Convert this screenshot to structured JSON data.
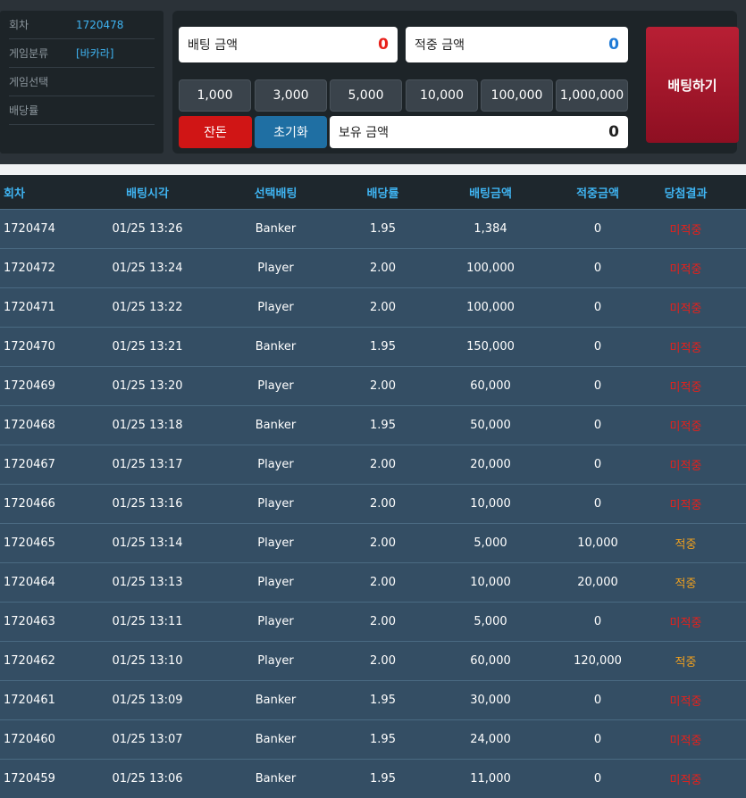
{
  "info": {
    "round_label": "회차",
    "round_value": "1720478",
    "category_label": "게임분류",
    "category_value": "[바카라]",
    "select_label": "게임선택",
    "select_value": "",
    "odds_label": "배당률",
    "odds_value": ""
  },
  "bet": {
    "amount_label": "배팅 금액",
    "amount_value": "0",
    "win_label": "적중 금액",
    "win_value": "0",
    "chips": [
      "1,000",
      "3,000",
      "5,000",
      "10,000",
      "100,000",
      "1,000,000"
    ],
    "change_label": "잔돈",
    "reset_label": "초기화",
    "balance_label": "보유 금액",
    "balance_value": "0",
    "submit_label": "배팅하기"
  },
  "colors": {
    "lose": "#e8201a",
    "win": "#f0a01e",
    "header_text": "#3fb4f2",
    "bet_button": "#a4172b"
  },
  "table": {
    "headers": [
      "회차",
      "배팅시각",
      "선택배팅",
      "배당률",
      "배팅금액",
      "적중금액",
      "당첨결과"
    ],
    "rows": [
      [
        "1720474",
        "01/25 13:26",
        "Banker",
        "1.95",
        "1,384",
        "0",
        "미적중"
      ],
      [
        "1720472",
        "01/25 13:24",
        "Player",
        "2.00",
        "100,000",
        "0",
        "미적중"
      ],
      [
        "1720471",
        "01/25 13:22",
        "Player",
        "2.00",
        "100,000",
        "0",
        "미적중"
      ],
      [
        "1720470",
        "01/25 13:21",
        "Banker",
        "1.95",
        "150,000",
        "0",
        "미적중"
      ],
      [
        "1720469",
        "01/25 13:20",
        "Player",
        "2.00",
        "60,000",
        "0",
        "미적중"
      ],
      [
        "1720468",
        "01/25 13:18",
        "Banker",
        "1.95",
        "50,000",
        "0",
        "미적중"
      ],
      [
        "1720467",
        "01/25 13:17",
        "Player",
        "2.00",
        "20,000",
        "0",
        "미적중"
      ],
      [
        "1720466",
        "01/25 13:16",
        "Player",
        "2.00",
        "10,000",
        "0",
        "미적중"
      ],
      [
        "1720465",
        "01/25 13:14",
        "Player",
        "2.00",
        "5,000",
        "10,000",
        "적중"
      ],
      [
        "1720464",
        "01/25 13:13",
        "Player",
        "2.00",
        "10,000",
        "20,000",
        "적중"
      ],
      [
        "1720463",
        "01/25 13:11",
        "Player",
        "2.00",
        "5,000",
        "0",
        "미적중"
      ],
      [
        "1720462",
        "01/25 13:10",
        "Player",
        "2.00",
        "60,000",
        "120,000",
        "적중"
      ],
      [
        "1720461",
        "01/25 13:09",
        "Banker",
        "1.95",
        "30,000",
        "0",
        "미적중"
      ],
      [
        "1720460",
        "01/25 13:07",
        "Banker",
        "1.95",
        "24,000",
        "0",
        "미적중"
      ],
      [
        "1720459",
        "01/25 13:06",
        "Banker",
        "1.95",
        "11,000",
        "0",
        "미적중"
      ]
    ]
  }
}
